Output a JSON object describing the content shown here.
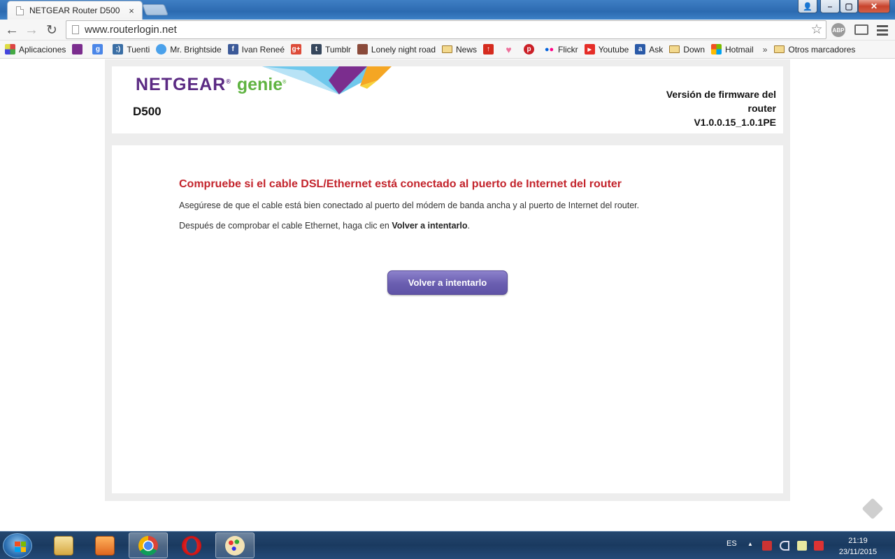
{
  "browser": {
    "tab_title": "NETGEAR Router D500",
    "tab_close": "×",
    "url": "www.routerlogin.net",
    "star": "☆",
    "abp": "ABP",
    "user_icon": "👤",
    "min_icon": "–",
    "max_icon": "▢",
    "close_icon": "✕"
  },
  "bookmarks": {
    "items": [
      {
        "label": "Aplicaciones",
        "icon": "apps-grid-icon",
        "color": "#d44"
      },
      {
        "label": "",
        "icon": "grid-icon",
        "color": "#7b2d8e"
      },
      {
        "label": "",
        "icon": "google-icon",
        "color": "#4a86e8"
      },
      {
        "label": "Tuenti",
        "icon": "tuenti-icon",
        "color": "#3a6ea5"
      },
      {
        "label": "Mr. Brightside",
        "icon": "twitter-icon",
        "color": "#4aa1eb"
      },
      {
        "label": "Ivan Reneé",
        "icon": "facebook-icon",
        "color": "#3b5998"
      },
      {
        "label": "",
        "icon": "google-plus-icon",
        "color": "#dd4b39"
      },
      {
        "label": "Tumblr",
        "icon": "tumblr-icon",
        "color": "#35465c"
      },
      {
        "label": "Lonely night road",
        "icon": "photo-icon",
        "color": "#8a4a3a"
      },
      {
        "label": "News",
        "icon": "folder-icon",
        "color": "#f3d98e"
      },
      {
        "label": "",
        "icon": "upload-icon",
        "color": "#d52b1e"
      },
      {
        "label": "",
        "icon": "heart-icon",
        "color": "#ee6f9a"
      },
      {
        "label": "",
        "icon": "pinterest-icon",
        "color": "#cb2027"
      },
      {
        "label": "Flickr",
        "icon": "flickr-icon",
        "color": "#0063dc"
      },
      {
        "label": "Youtube",
        "icon": "youtube-icon",
        "color": "#e52d27"
      },
      {
        "label": "Ask",
        "icon": "ask-icon",
        "color": "#2a5aa8"
      },
      {
        "label": "Down",
        "icon": "folder-icon",
        "color": "#f3d98e"
      },
      {
        "label": "Hotmail",
        "icon": "windows-icon",
        "color": "#f25022"
      }
    ],
    "more": "»",
    "other": "Otros marcadores"
  },
  "router": {
    "brand": "NETGEAR",
    "brand_mark": "®",
    "genie": "genie",
    "genie_mark": "®",
    "model": "D500",
    "firmware_label": "Versión de firmware del router",
    "firmware_version": "V1.0.0.15_1.0.1PE",
    "error_title": "Compruebe si el cable DSL/Ethernet está conectado al puerto de Internet del router",
    "error_line1": "Asegúrese de que el cable está bien conectado al puerto del módem de banda ancha y al puerto de Internet del router.",
    "error_line2_prefix": "Después de comprobar el cable Ethernet, haga clic en ",
    "error_line2_bold": "Volver a intentarlo",
    "error_line2_suffix": ".",
    "retry_button": "Volver a intentarlo",
    "accent_purple": "#5b2a83",
    "accent_green": "#5fb341",
    "error_red": "#c3242c"
  },
  "taskbar": {
    "items": [
      "file-explorer-icon",
      "media-player-icon",
      "chrome-icon",
      "opera-icon",
      "paint-icon"
    ],
    "language": "ES",
    "tray_arrow": "▲",
    "time": "21:19",
    "date": "23/11/2015"
  }
}
